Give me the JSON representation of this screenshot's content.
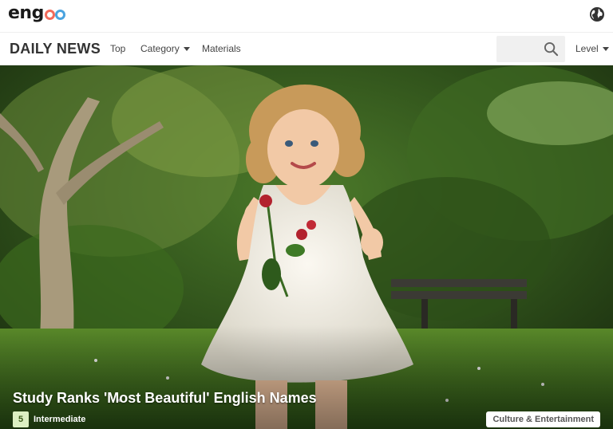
{
  "header": {
    "logo_text": "engoo",
    "globe_icon": "globe-icon"
  },
  "nav": {
    "brand": "DAILY NEWS",
    "items": [
      {
        "label": "Top"
      },
      {
        "label": "Category",
        "dropdown": true
      },
      {
        "label": "Materials"
      }
    ],
    "search": {
      "placeholder": "",
      "icon": "search-icon"
    },
    "level_label": "Level"
  },
  "hero": {
    "title": "Study Ranks 'Most Beautiful' English Names",
    "level_number": "5",
    "level_name": "Intermediate",
    "category": "Culture & Entertainment"
  },
  "colors": {
    "accent_red": "#f26b5b",
    "accent_blue": "#4aa3df",
    "level_badge": "#dcefc2"
  }
}
